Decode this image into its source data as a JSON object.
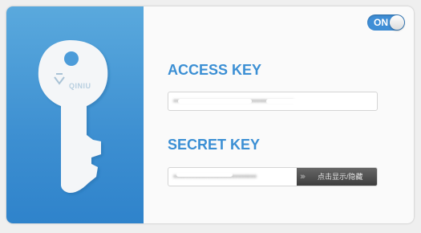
{
  "toggle": {
    "label": "ON",
    "state": "on"
  },
  "branding": {
    "logo_text": "QINIU"
  },
  "access_key": {
    "title": "ACCESS KEY",
    "value": "•••••••••••••••••••••••••••••••••••••••"
  },
  "secret_key": {
    "title": "SECRET KEY",
    "value": "•••••••••••••••••••••••••••",
    "reveal_label": "点击显示/隐藏"
  },
  "colors": {
    "accent": "#3b8fd4",
    "panel_top": "#5aa9dd",
    "panel_bottom": "#2f83cb"
  },
  "icons": {
    "key": "key-icon",
    "reveal": "double-chevron-right-icon"
  }
}
